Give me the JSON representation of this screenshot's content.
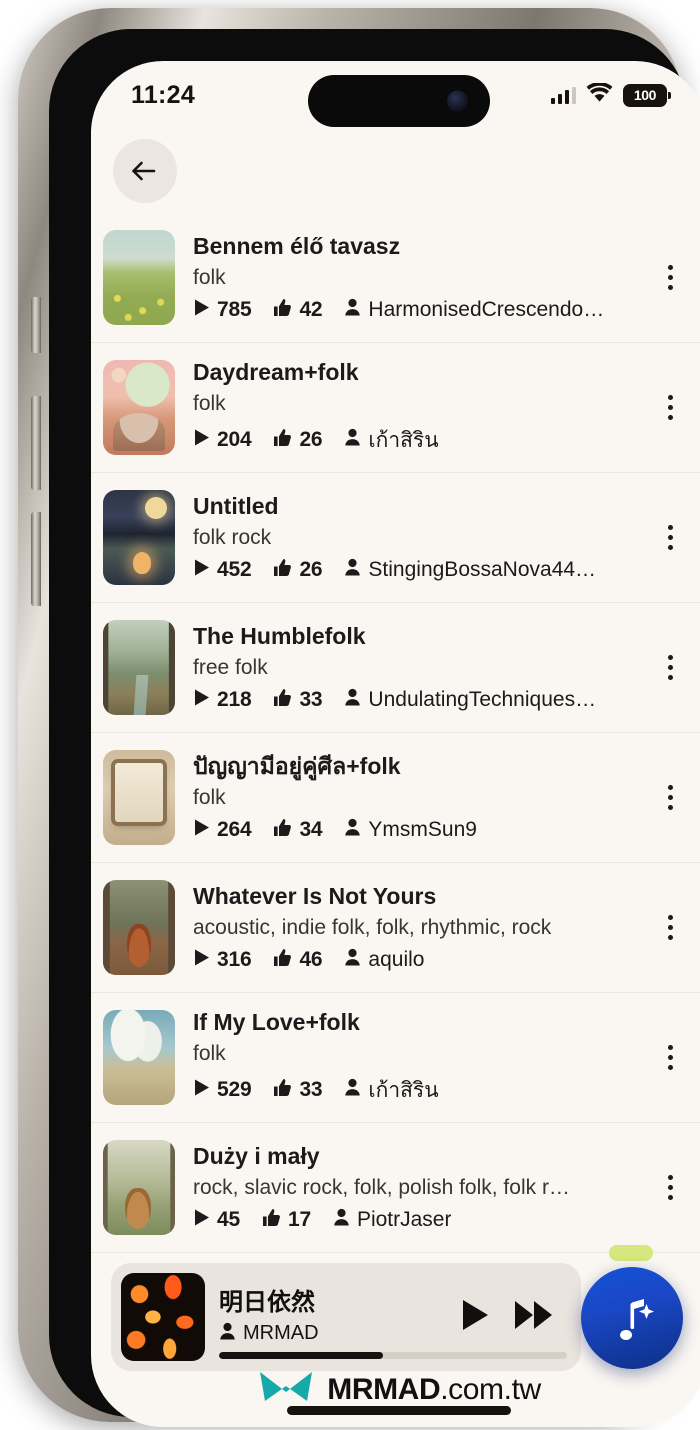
{
  "status_bar": {
    "time": "11:24",
    "battery_level": "100",
    "signal_bars": 4,
    "signal_filled": 3
  },
  "nav": {
    "back_label": "Back"
  },
  "songs": [
    {
      "title": "Bennem élő tavasz",
      "genre": "folk",
      "plays": "785",
      "likes": "42",
      "uploader": "HarmonisedCrescendo…",
      "art": "art-meadow"
    },
    {
      "title": "Daydream+folk",
      "genre": "folk",
      "plays": "204",
      "likes": "26",
      "uploader": "เก้าสิริน",
      "art": "art-ufo"
    },
    {
      "title": "Untitled",
      "genre": "folk rock",
      "plays": "452",
      "likes": "26",
      "uploader": "StingingBossaNova44…",
      "art": "art-night"
    },
    {
      "title": "The Humblefolk",
      "genre": "free folk",
      "plays": "218",
      "likes": "33",
      "uploader": "UndulatingTechniques…",
      "art": "art-forest"
    },
    {
      "title": "ปัญญามีอยู่คู่ศีล+folk",
      "genre": "folk",
      "plays": "264",
      "likes": "34",
      "uploader": "YmsmSun9",
      "art": "art-scroll"
    },
    {
      "title": "Whatever Is Not Yours",
      "genre": "acoustic, indie folk, folk, rhythmic, rock",
      "plays": "316",
      "likes": "46",
      "uploader": "aquilo",
      "art": "art-guitar-tree"
    },
    {
      "title": "If My Love+folk",
      "genre": "folk",
      "plays": "529",
      "likes": "33",
      "uploader": "เก้าสิริน",
      "art": "art-clouds"
    },
    {
      "title": "Duży i mały",
      "genre": "rock, slavic rock, folk, polish folk, folk r…",
      "plays": "45",
      "likes": "17",
      "uploader": "PiotrJaser",
      "art": "art-guitar-forest"
    }
  ],
  "player": {
    "title": "明日依然",
    "artist": "MRMAD",
    "progress_percent": 47,
    "play_label": "Play",
    "next_label": "Fast forward"
  },
  "fab": {
    "label": "Generate music"
  },
  "watermark": {
    "brand": "MRMAD",
    "domain": ".com.tw"
  },
  "colors": {
    "screen_background": "#faf6f1",
    "player_background": "#eae4de",
    "fab_blue": "#1452d8",
    "badge_green": "#d6e77e",
    "logo_teal": "#17a9a9",
    "text_primary": "#1b1b1b"
  }
}
